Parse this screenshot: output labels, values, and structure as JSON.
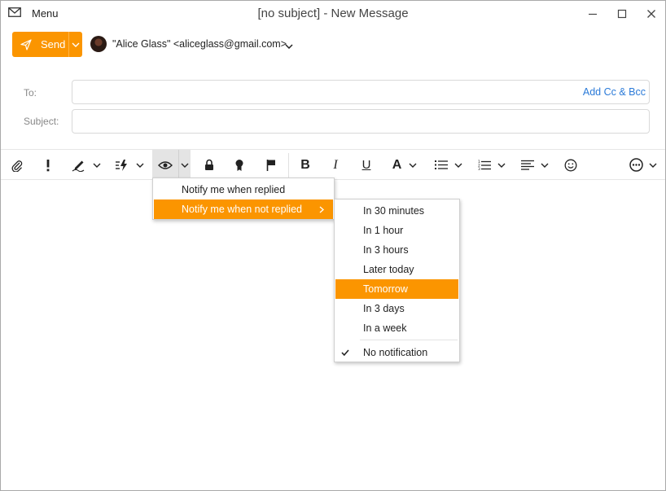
{
  "window": {
    "menu_label": "Menu",
    "title": "[no subject] - New Message"
  },
  "compose": {
    "send_label": "Send",
    "from": "\"Alice Glass\" <aliceglass@gmail.com>",
    "to_label": "To:",
    "to_value": "",
    "add_cc_bcc": "Add Cc & Bcc",
    "subject_label": "Subject:",
    "subject_value": ""
  },
  "toolbar": {
    "buttons": [
      "paperclip-icon",
      "exclamation-icon",
      "pen-icon",
      "quick-parts-icon",
      "eye-icon",
      "lock-icon",
      "seal-icon",
      "flag-icon",
      "bold-icon",
      "italic-icon",
      "underline-icon",
      "font-color-icon",
      "bullet-list-icon",
      "numbered-list-icon",
      "align-icon",
      "emoji-icon",
      "more-icon"
    ],
    "bold": "B",
    "italic": "I",
    "underline": "U",
    "font_color": "A"
  },
  "tracking_menu": {
    "items": [
      {
        "label": "Notify me when replied"
      },
      {
        "label": "Notify me when not replied"
      }
    ],
    "highlighted_index": 1
  },
  "reminder_submenu": {
    "items": [
      {
        "label": "In 30 minutes"
      },
      {
        "label": "In 1 hour"
      },
      {
        "label": "In 3 hours"
      },
      {
        "label": "Later today"
      },
      {
        "label": "Tomorrow"
      },
      {
        "label": "In 3 days"
      },
      {
        "label": "In a week"
      },
      {
        "label": "No notification"
      }
    ],
    "highlighted_index": 4,
    "checked_index": 7
  },
  "colors": {
    "accent": "#fb9500",
    "link": "#2a7ad8"
  }
}
